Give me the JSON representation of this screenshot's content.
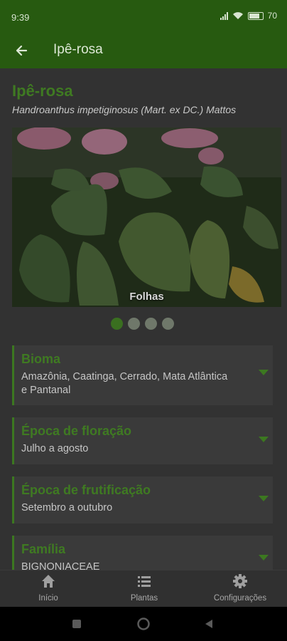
{
  "status": {
    "time": "9:39",
    "battery": "70"
  },
  "appbar": {
    "back_icon": "arrow-left-icon",
    "title": "Ipê-rosa"
  },
  "plant": {
    "name": "Ipê-rosa",
    "scientific_name": "Handroanthus impetiginosus (Mart. ex DC.) Mattos",
    "photo_caption": "Folhas",
    "carousel": {
      "count": 4,
      "active_index": 0
    }
  },
  "cards": [
    {
      "title": "Bioma",
      "value": "Amazônia, Caatinga, Cerrado, Mata Atlântica e Pantanal"
    },
    {
      "title": "Época de floração",
      "value": "Julho a agosto"
    },
    {
      "title": "Época de frutificação",
      "value": "Setembro a outubro"
    },
    {
      "title": "Família",
      "value": "BIGNONIACEAE"
    }
  ],
  "bottom_nav": [
    {
      "label": "Início",
      "icon": "home-icon"
    },
    {
      "label": "Plantas",
      "icon": "list-icon"
    },
    {
      "label": "Configurações",
      "icon": "gear-icon"
    }
  ],
  "colors": {
    "primary": "#275a10",
    "accent": "#3f7a22"
  }
}
